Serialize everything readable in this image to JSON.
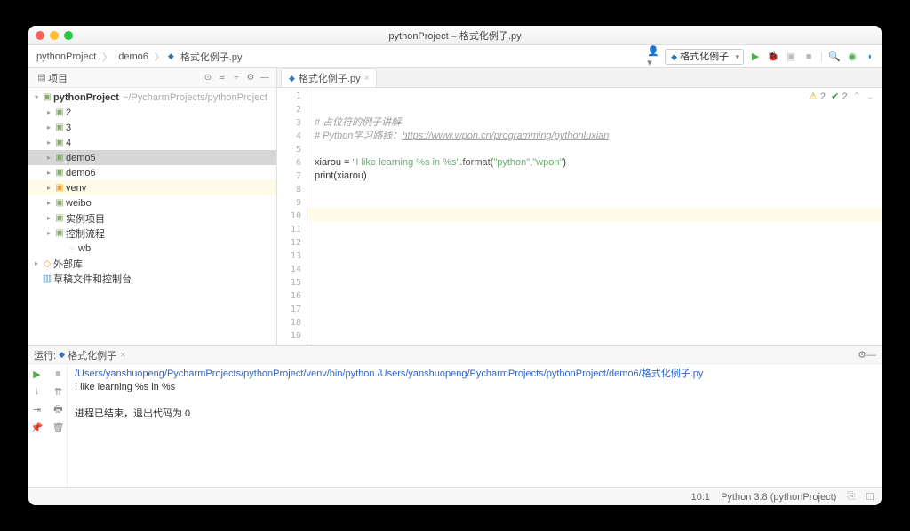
{
  "title": "pythonProject – 格式化例子.py",
  "breadcrumbs": {
    "a": "pythonProject",
    "b": "demo6",
    "c": "格式化例子.py"
  },
  "sidebar": {
    "header": "项目",
    "root": {
      "name": "pythonProject",
      "path": "~/PycharmProjects/pythonProject"
    },
    "items": [
      {
        "name": "2"
      },
      {
        "name": "3"
      },
      {
        "name": "4"
      },
      {
        "name": "demo5",
        "sel": true
      },
      {
        "name": "demo6"
      },
      {
        "name": "venv",
        "orange": true
      },
      {
        "name": "weibo"
      },
      {
        "name": "实例项目"
      },
      {
        "name": "控制流程"
      }
    ],
    "wb": "wb",
    "ext": "外部库",
    "scratch": "草稿文件和控制台"
  },
  "run_config": "格式化例子",
  "tab": {
    "name": "格式化例子.py"
  },
  "code": {
    "line1_a": "# 占位符的例子讲解",
    "line2_a": "# Python学习路线：",
    "line2_b": "https://www.wpon.cn/programming/pythonluxian",
    "line4_a": "xiarou = ",
    "line4_b": "\"I like learning %s in %s\"",
    "line4_c": ".format(",
    "line4_d": "\"python\"",
    "line4_e": ",",
    "line4_f": "\"wpon\"",
    "line4_g": ")",
    "line5_a": "print",
    "line5_b": "(xiarou)"
  },
  "badges": {
    "warn": "2",
    "check": "2"
  },
  "run": {
    "header_label": "运行:",
    "tab": "格式化例子",
    "path": "/Users/yanshuopeng/PycharmProjects/pythonProject/venv/bin/python /Users/yanshuopeng/PycharmProjects/pythonProject/demo6/格式化例子.py",
    "out": "I like learning %s in %s",
    "exit": "进程已结束，退出代码为 0"
  },
  "status": {
    "pos": "10:1",
    "py": "Python 3.8 (pythonProject)"
  }
}
